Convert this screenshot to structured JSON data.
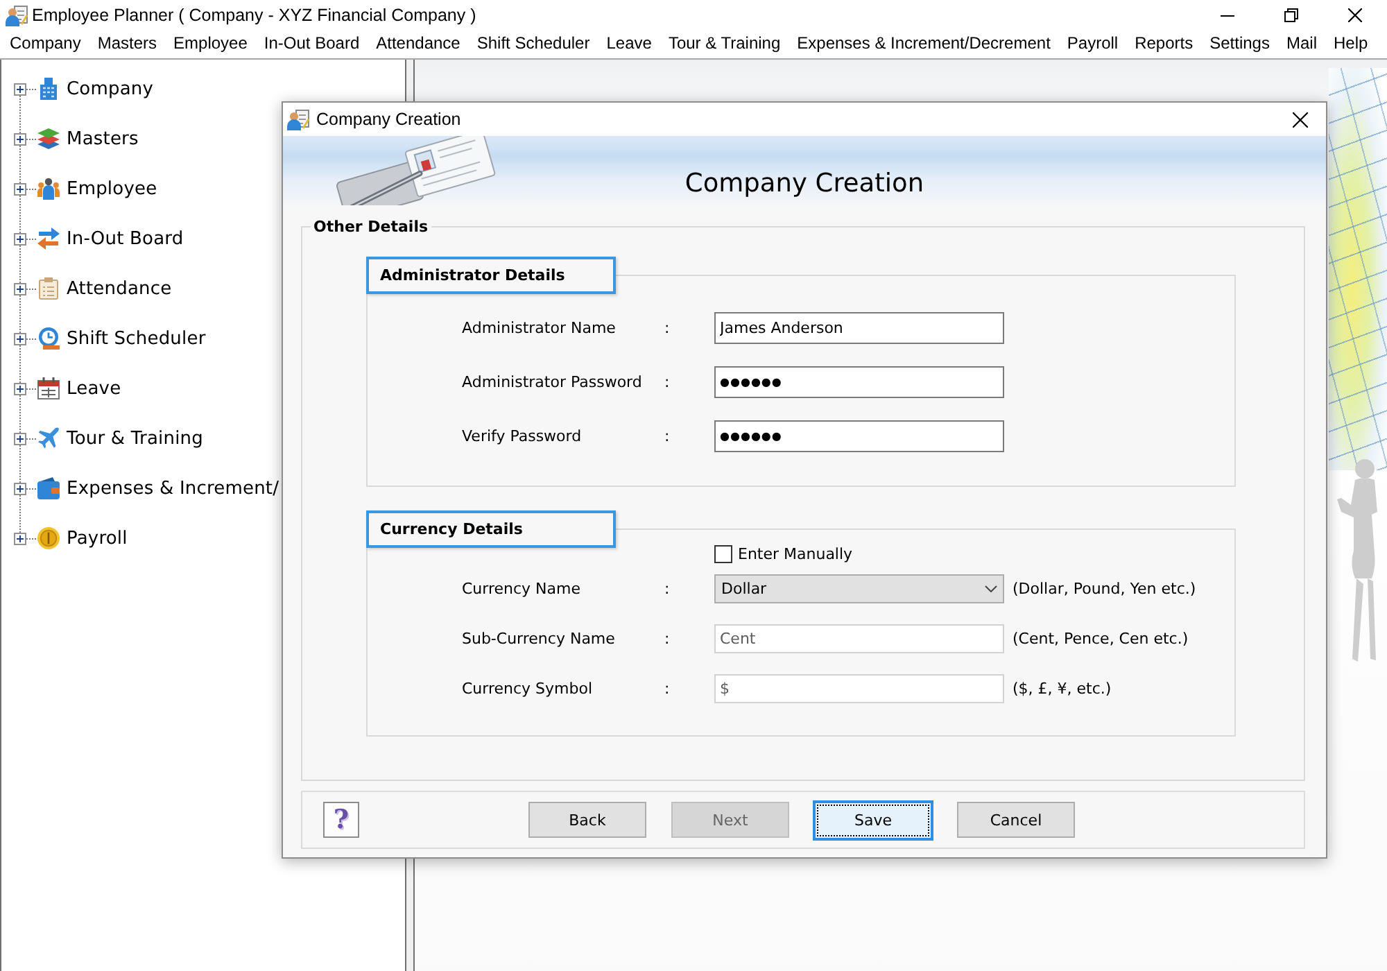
{
  "window": {
    "title": "Employee Planner ( Company - XYZ Financial Company )"
  },
  "menu": [
    "Company",
    "Masters",
    "Employee",
    "In-Out Board",
    "Attendance",
    "Shift Scheduler",
    "Leave",
    "Tour & Training",
    "Expenses & Increment/Decrement",
    "Payroll",
    "Reports",
    "Settings",
    "Mail",
    "Help"
  ],
  "tree": [
    {
      "label": "Company",
      "expanded": false
    },
    {
      "label": "Masters",
      "expanded": false
    },
    {
      "label": "Employee",
      "expanded": false
    },
    {
      "label": "In-Out Board",
      "expanded": false
    },
    {
      "label": "Attendance",
      "expanded": false
    },
    {
      "label": "Shift Scheduler",
      "expanded": false
    },
    {
      "label": "Leave",
      "expanded": false
    },
    {
      "label": "Tour & Training",
      "expanded": false
    },
    {
      "label": "Expenses & Increment/",
      "expanded": false
    },
    {
      "label": "Payroll",
      "expanded": false
    }
  ],
  "dialog": {
    "title": "Company Creation",
    "heading": "Company Creation",
    "other_details": {
      "legend": "Other Details"
    },
    "administrator": {
      "legend": "Administrator Details",
      "fields": [
        {
          "kind": "text",
          "label": "Administrator Name",
          "colon": ":",
          "value": "James Anderson"
        },
        {
          "kind": "password",
          "label": "Administrator Password",
          "colon": ":",
          "value": "●●●●●●"
        },
        {
          "kind": "password",
          "label": "Verify Password",
          "colon": ":",
          "value": "●●●●●●"
        }
      ]
    },
    "currency": {
      "legend": "Currency Details",
      "manual": {
        "label": "Enter Manually",
        "checked": false
      },
      "fields": [
        {
          "kind": "dropdown",
          "label": "Currency Name",
          "colon": ":",
          "value": "Dollar",
          "disabled": false,
          "hint": "(Dollar, Pound, Yen etc.)"
        },
        {
          "kind": "text",
          "label": "Sub-Currency Name",
          "colon": ":",
          "value": "Cent",
          "disabled": true,
          "hint": "(Cent, Pence, Cen etc.)"
        },
        {
          "kind": "text",
          "label": "Currency Symbol",
          "colon": ":",
          "value": "$",
          "disabled": true,
          "hint": "($, £, ¥, etc.)"
        }
      ]
    },
    "help": "?",
    "buttons": [
      {
        "label": "Back",
        "disabled": false,
        "focused": false
      },
      {
        "label": "Next",
        "disabled": true,
        "focused": false
      },
      {
        "label": "Save",
        "disabled": false,
        "focused": true
      },
      {
        "label": "Cancel",
        "disabled": false,
        "focused": false
      }
    ]
  }
}
